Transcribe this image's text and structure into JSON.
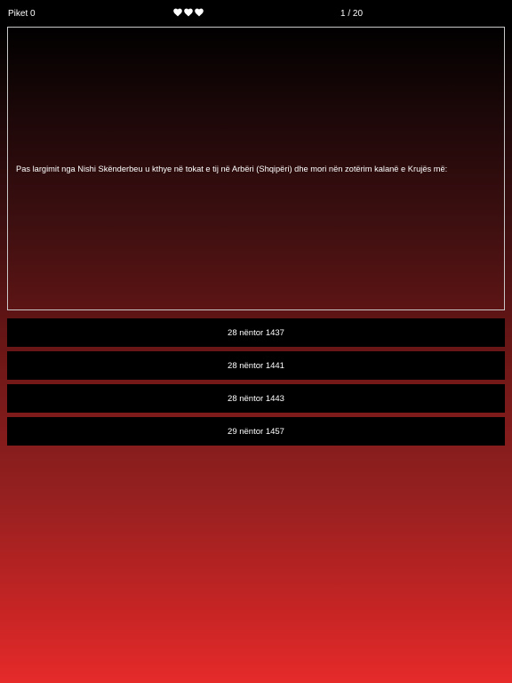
{
  "status": {
    "score_label": "Piket 0",
    "lives": [
      "heart-icon",
      "heart-icon",
      "heart-icon"
    ],
    "progress": "1 / 20"
  },
  "question": {
    "text": "Pas largimit nga Nishi Skënderbeu u kthye në tokat e tij në Arbëri (Shqipëri) dhe mori nën zotërim kalanë e Krujës më:"
  },
  "answers": [
    {
      "label": "28 nëntor 1437"
    },
    {
      "label": "28 nëntor 1441"
    },
    {
      "label": "28 nëntor 1443"
    },
    {
      "label": "29 nëntor 1457"
    }
  ],
  "colors": {
    "background_top": "#000000",
    "background_bottom": "#e62a2a",
    "answer_button": "#000000",
    "text": "#ffffff",
    "question_border": "#c8c8c8"
  }
}
